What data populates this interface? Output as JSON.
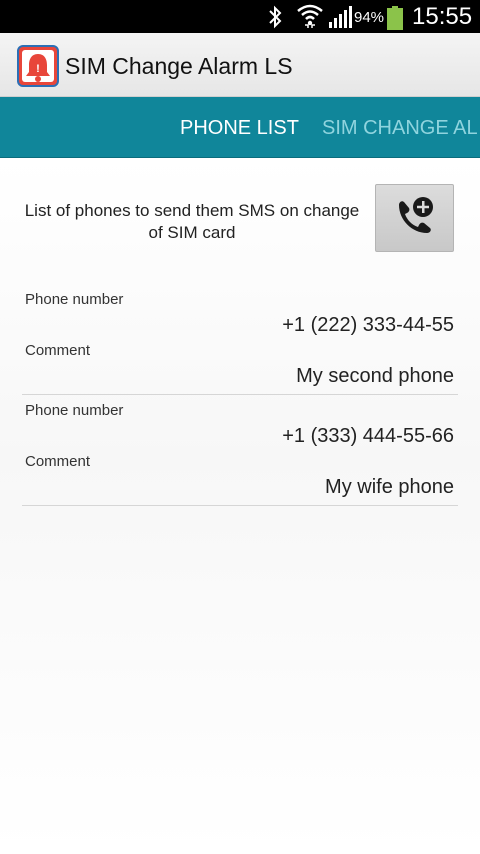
{
  "status_bar": {
    "battery_percent": "94%",
    "time": "15:55",
    "icons": [
      "bluetooth-icon",
      "wifi-icon",
      "signal-icon",
      "battery-icon"
    ],
    "battery_level": 0.94
  },
  "action_bar": {
    "app_icon": "alarm-bell-icon",
    "title": "SIM Change Alarm LS"
  },
  "tabs": [
    {
      "label": "PHONE LIST",
      "active": true
    },
    {
      "label": "SIM CHANGE AL",
      "active": false
    }
  ],
  "colors": {
    "tab_bar": "#10869a",
    "tab_active_text": "#ffffff",
    "tab_inactive_text": "#8fd4de"
  },
  "intro": {
    "text": "List of phones to send them SMS on change of SIM card",
    "add_button_icon": "add-phone-icon"
  },
  "phones": [
    {
      "phone_label": "Phone number",
      "phone": "+1 (222) 333-44-55",
      "comment_label": "Comment",
      "comment": "My second phone"
    },
    {
      "phone_label": "Phone number",
      "phone": "+1 (333) 444-55-66",
      "comment_label": "Comment",
      "comment": "My wife phone"
    }
  ]
}
